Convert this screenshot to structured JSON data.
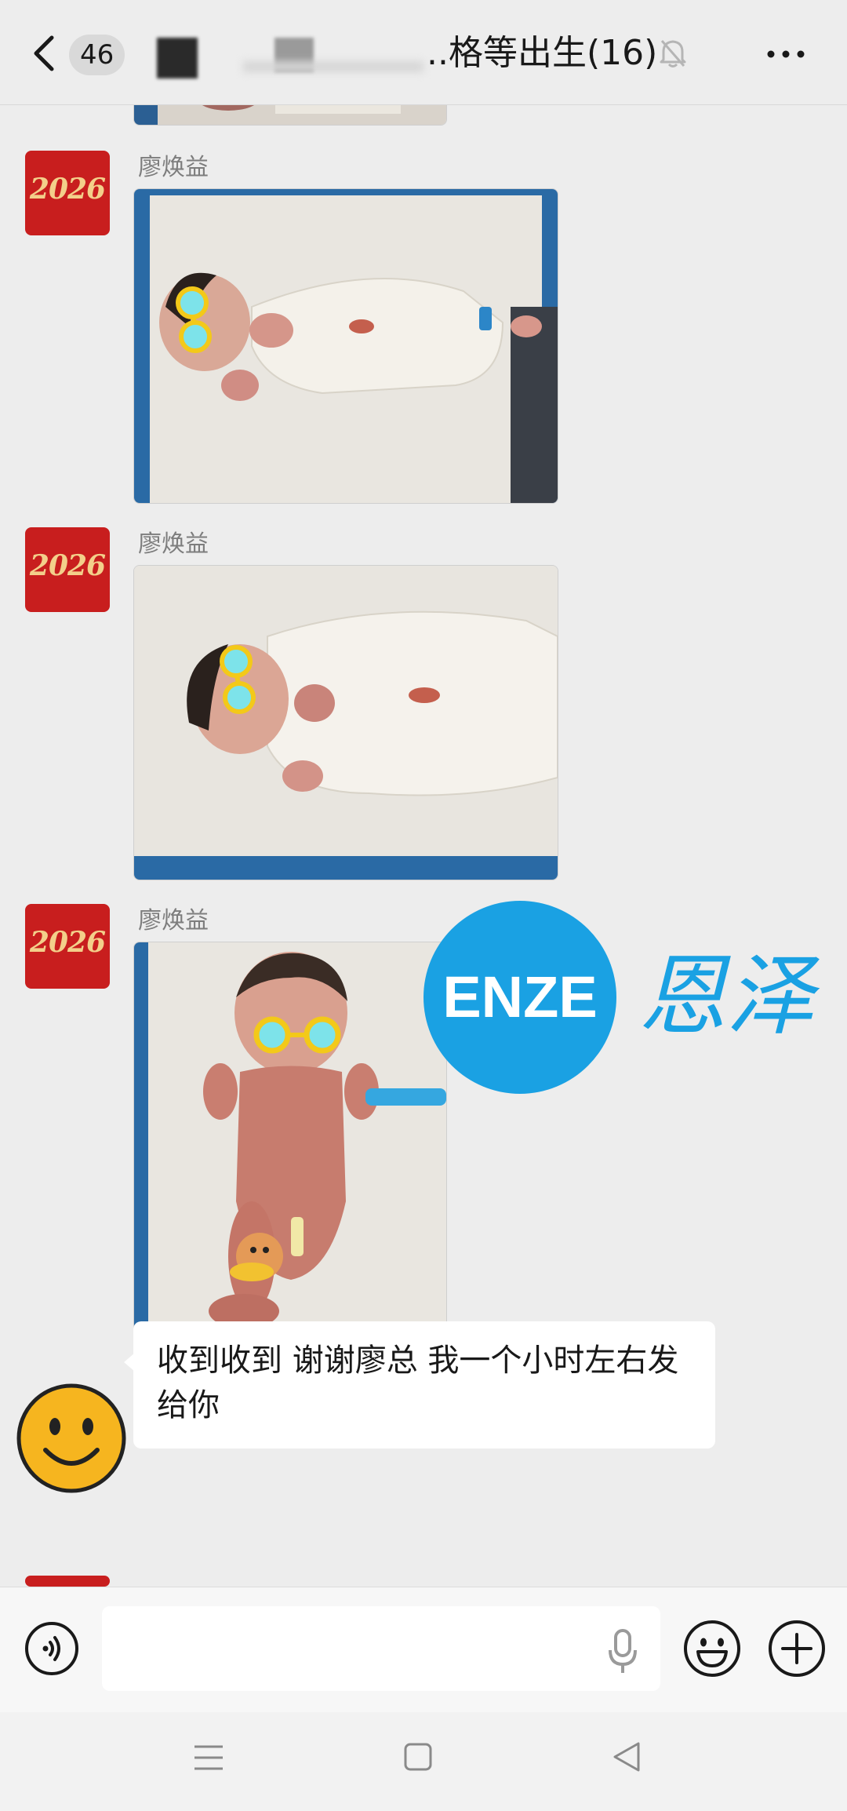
{
  "header": {
    "unread_count": "46",
    "title": "..格等出生(16)",
    "icons": {
      "back": "chevron-left-icon",
      "mute": "bell-off-icon",
      "more": "more-horizontal-icon"
    }
  },
  "messages": [
    {
      "type": "image",
      "sender": "",
      "partial": true
    },
    {
      "type": "image",
      "sender": "廖焕益",
      "avatar_text": "2026"
    },
    {
      "type": "image",
      "sender": "廖焕益",
      "avatar_text": "2026"
    },
    {
      "type": "image",
      "sender": "廖焕益",
      "avatar_text": "2026"
    },
    {
      "type": "text",
      "sender": "",
      "text": "收到收到 谢谢廖总 我一个小时左右发给你"
    }
  ],
  "watermark": {
    "logo": "ENZE",
    "text": "恩泽"
  },
  "input_bar": {
    "placeholder": "",
    "icons": [
      "voice-icon",
      "microphone-icon",
      "emoji-icon",
      "plus-icon"
    ]
  },
  "nav_bar": {
    "icons": [
      "menu-icon",
      "home-icon",
      "back-triangle-icon"
    ]
  },
  "colors": {
    "background": "#ededed",
    "accent": "#1aa1e3",
    "avatar_red": "#c81e1e",
    "bubble": "#ffffff"
  }
}
